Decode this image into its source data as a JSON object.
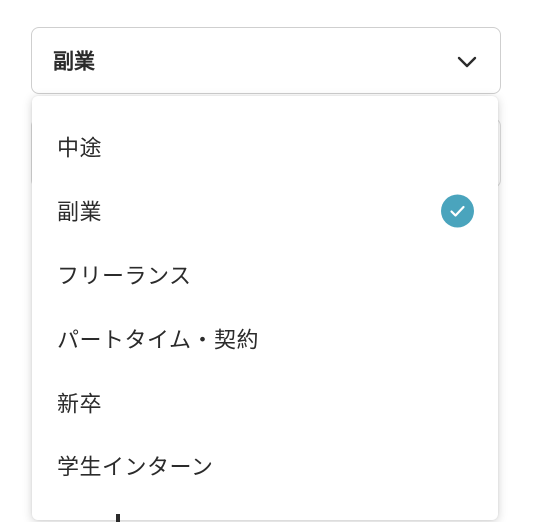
{
  "select": {
    "value": "副業",
    "icon": "chevron-down-icon"
  },
  "dropdown": {
    "options": [
      {
        "label": "中途",
        "selected": false
      },
      {
        "label": "副業",
        "selected": true
      },
      {
        "label": "フリーランス",
        "selected": false
      },
      {
        "label": "パートタイム・契約",
        "selected": false
      },
      {
        "label": "新卒",
        "selected": false
      },
      {
        "label": "学生インターン",
        "selected": false
      }
    ],
    "check_icon": "check-circle-icon"
  },
  "colors": {
    "accent": "#4aa4bd",
    "text": "#2b2b2b",
    "border": "#cfcfcf"
  }
}
